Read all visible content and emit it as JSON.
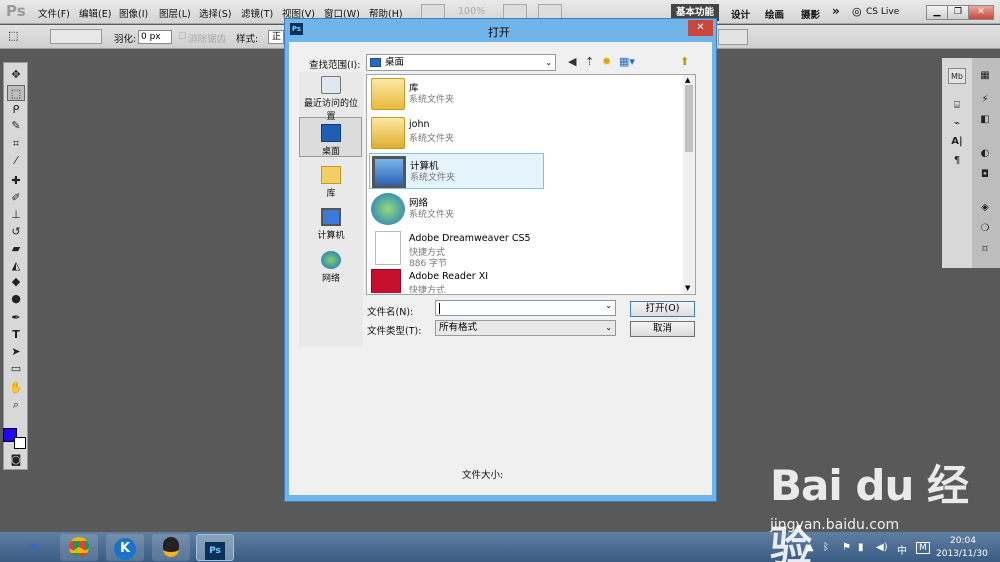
{
  "app": {
    "logo": "Ps",
    "menu": [
      "文件(F)",
      "编辑(E)",
      "图像(I)",
      "图层(L)",
      "选择(S)",
      "滤镜(T)",
      "视图(V)",
      "窗口(W)",
      "帮助(H)"
    ],
    "zoom": "100%",
    "workspace_active": "基本功能",
    "workspaces": [
      "设计",
      "绘画",
      "摄影"
    ],
    "more": "»",
    "cs_live": "CS Live"
  },
  "options": {
    "feather_label": "羽化:",
    "feather_value": "0 px",
    "antialias_label": "消除锯齿",
    "style_label": "样式:",
    "style_value": "正"
  },
  "dialog": {
    "title": "打开",
    "close": "✕",
    "lookin_label": "查找范围(I):",
    "lookin_value": "桌面",
    "places": [
      {
        "label": "最近访问的位置",
        "icon": "recent-places-icon"
      },
      {
        "label": "桌面",
        "icon": "desktop-icon"
      },
      {
        "label": "库",
        "icon": "library-icon"
      },
      {
        "label": "计算机",
        "icon": "computer-icon"
      },
      {
        "label": "网络",
        "icon": "network-icon"
      }
    ],
    "files": [
      {
        "name": "库",
        "type": "系统文件夹",
        "icon": "library-folder-icon"
      },
      {
        "name": "john",
        "type": "系统文件夹",
        "icon": "user-folder-icon"
      },
      {
        "name": "计算机",
        "type": "系统文件夹",
        "icon": "computer-icon",
        "selected": true
      },
      {
        "name": "网络",
        "type": "系统文件夹",
        "icon": "network-globe-icon"
      },
      {
        "name": "Adobe Dreamweaver CS5",
        "type": "快捷方式",
        "size": "886 字节",
        "icon": "shortcut-file-icon"
      },
      {
        "name": "Adobe Reader XI",
        "type": "快捷方式",
        "icon": "adobe-reader-icon"
      }
    ],
    "filename_label": "文件名(N):",
    "filename_value": "",
    "filetype_label": "文件类型(T):",
    "filetype_value": "所有格式",
    "open_button": "打开(O)",
    "cancel_button": "取消",
    "filesize_label": "文件大小:"
  },
  "taskbar": {
    "time": "20:04",
    "date": "2013/11/30",
    "ime": "中",
    "m_icon": "M"
  },
  "watermark": {
    "text": "Bai du 经验",
    "url": "jingyan.baidu.com"
  }
}
